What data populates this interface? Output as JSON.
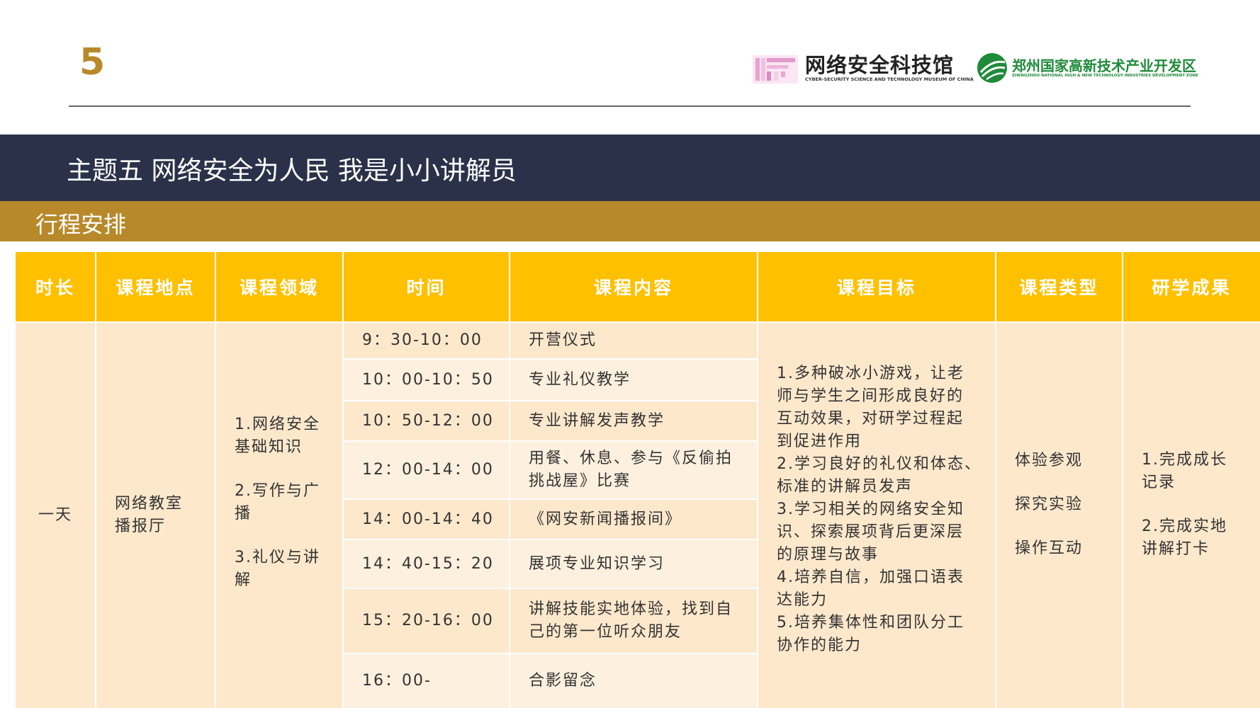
{
  "header": {
    "page_number": "5",
    "logo1": {
      "name_cn": "网络安全科技馆",
      "name_en": "CYBER-SECURITY SCIENCE AND TECHNOLOGY MUSEUM OF CHINA"
    },
    "logo2": {
      "name_cn": "郑州国家高新技术产业开发区",
      "name_en": "ZHENGZHOU NATIONAL HIGH & NEW TECHNOLOGY INDUSTRIES DEVELOPMENT ZONE"
    }
  },
  "title": "主题五 网络安全为人民 我是小小讲解员",
  "subtitle": "行程安排",
  "colors": {
    "navy": "#2a3149",
    "gold": "#b8892a",
    "header_yellow": "#ffc000",
    "cell_peach": "#fde8cc",
    "green": "#1f8a3a"
  },
  "table": {
    "headers": [
      "时长",
      "课程地点",
      "课程领域",
      "时间",
      "课程内容",
      "课程目标",
      "课程类型",
      "研学成果"
    ],
    "duration": "一天",
    "location": [
      "网络教室",
      "播报厅"
    ],
    "domains": [
      [
        "1.网络安全",
        "基础知识"
      ],
      [
        "2.写作与广",
        "播"
      ],
      [
        "3.礼仪与讲",
        "解"
      ]
    ],
    "schedule": [
      {
        "time": "9：30-10：00",
        "content": [
          "开营仪式"
        ]
      },
      {
        "time": "10：00-10：50",
        "content": [
          "专业礼仪教学"
        ]
      },
      {
        "time": "10：50-12：00",
        "content": [
          "专业讲解发声教学"
        ]
      },
      {
        "time": "12：00-14：00",
        "content": [
          "用餐、休息、参与《反偷拍",
          "挑战屋》比赛"
        ]
      },
      {
        "time": "14：00-14：40",
        "content": [
          "《网安新闻播报间》"
        ]
      },
      {
        "time": "14：40-15：20",
        "content": [
          "展项专业知识学习"
        ]
      },
      {
        "time": "15：20-16：00",
        "content": [
          "讲解技能实地体验，找到自",
          "己的第一位听众朋友"
        ]
      },
      {
        "time": "16：00-",
        "content": [
          "合影留念"
        ]
      }
    ],
    "goals": [
      "1.多种破冰小游戏，让老",
      "师与学生之间形成良好的",
      "互动效果，对研学过程起",
      "到促进作用",
      "2.学习良好的礼仪和体态、",
      "标准的讲解员发声",
      "3.学习相关的网络安全知",
      "识、探索展项背后更深层",
      "的原理与故事",
      "4.培养自信，加强口语表",
      "达能力",
      "5.培养集体性和团队分工",
      "协作的能力"
    ],
    "types": [
      "体验参观",
      "探究实验",
      "操作互动"
    ],
    "results": [
      [
        "1.完成成长",
        "记录"
      ],
      [
        "2.完成实地",
        "讲解打卡"
      ]
    ]
  }
}
